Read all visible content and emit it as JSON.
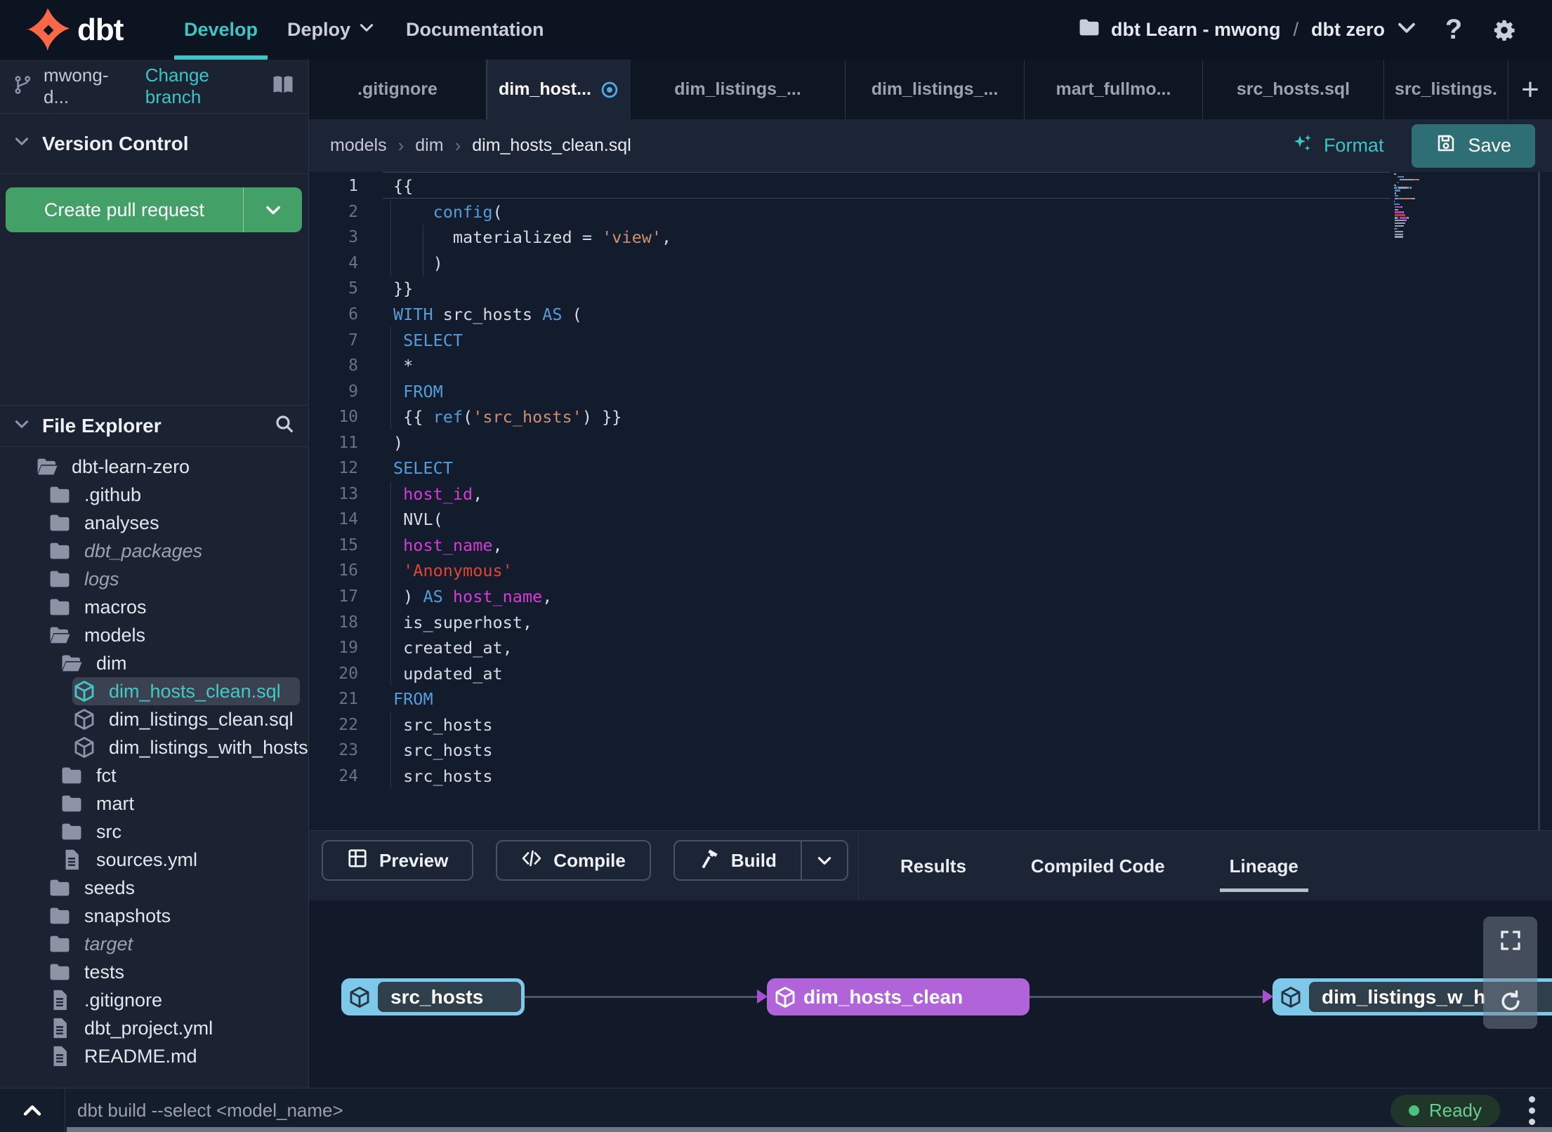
{
  "colors": {
    "accent_teal": "#3EC4C4",
    "green_button": "#43A168",
    "save_button": "#2E6F75",
    "node_source_blue": "#7EC8E9",
    "node_model_purple": "#B164DA",
    "ready_green": "#67CD93",
    "code_keyword": "#559CD8",
    "code_string": "#CE8F70",
    "code_string_red": "#E0452F",
    "code_field": "#D73BD8"
  },
  "topnav": {
    "brand": "dbt",
    "items": [
      {
        "label": "Develop",
        "active": true
      },
      {
        "label": "Deploy",
        "chevron": true
      },
      {
        "label": "Documentation"
      }
    ],
    "project": {
      "name": "dbt Learn - mwong",
      "sep": "/",
      "env": "dbt zero"
    }
  },
  "sidebar": {
    "branch": {
      "name": "mwong-d...",
      "action": "Change branch"
    },
    "version_control": {
      "title": "Version Control",
      "button": "Create pull request"
    },
    "file_explorer": {
      "title": "File Explorer",
      "items": [
        {
          "label": "dbt-learn-zero",
          "depth": 1,
          "icon": "folder-open"
        },
        {
          "label": ".github",
          "depth": 2,
          "icon": "folder"
        },
        {
          "label": "analyses",
          "depth": 2,
          "icon": "folder"
        },
        {
          "label": "dbt_packages",
          "depth": 2,
          "icon": "folder",
          "italic": true
        },
        {
          "label": "logs",
          "depth": 2,
          "icon": "folder",
          "italic": true
        },
        {
          "label": "macros",
          "depth": 2,
          "icon": "folder"
        },
        {
          "label": "models",
          "depth": 2,
          "icon": "folder-open"
        },
        {
          "label": "dim",
          "depth": 3,
          "icon": "folder-open"
        },
        {
          "label": "dim_hosts_clean.sql",
          "depth": 4,
          "icon": "cube",
          "selected": true,
          "dot": true
        },
        {
          "label": "dim_listings_clean.sql",
          "depth": 4,
          "icon": "cube"
        },
        {
          "label": "dim_listings_with_hosts...",
          "depth": 4,
          "icon": "cube"
        },
        {
          "label": "fct",
          "depth": 3,
          "icon": "folder"
        },
        {
          "label": "mart",
          "depth": 3,
          "icon": "folder"
        },
        {
          "label": "src",
          "depth": 3,
          "icon": "folder"
        },
        {
          "label": "sources.yml",
          "depth": 3,
          "icon": "file"
        },
        {
          "label": "seeds",
          "depth": 2,
          "icon": "folder"
        },
        {
          "label": "snapshots",
          "depth": 2,
          "icon": "folder"
        },
        {
          "label": "target",
          "depth": 2,
          "icon": "folder",
          "italic": true
        },
        {
          "label": "tests",
          "depth": 2,
          "icon": "folder"
        },
        {
          "label": ".gitignore",
          "depth": 2,
          "icon": "file"
        },
        {
          "label": "dbt_project.yml",
          "depth": 2,
          "icon": "file"
        },
        {
          "label": "README.md",
          "depth": 2,
          "icon": "file"
        }
      ]
    }
  },
  "tabs": {
    "items": [
      {
        "label": ".gitignore"
      },
      {
        "label": "dim_host...",
        "active": true,
        "dirty": true
      },
      {
        "label": "dim_listings_..."
      },
      {
        "label": "dim_listings_..."
      },
      {
        "label": "mart_fullmo..."
      },
      {
        "label": "src_hosts.sql"
      },
      {
        "label": "src_listings."
      }
    ],
    "add": "+"
  },
  "breadcrumb": {
    "items": [
      "models",
      "dim",
      "dim_hosts_clean.sql"
    ]
  },
  "actions": {
    "format": "Format",
    "save": "Save"
  },
  "editor": {
    "lines": [
      {
        "n": "1",
        "seg": [
          [
            "p",
            "{{"
          ]
        ]
      },
      {
        "n": "2",
        "seg": [
          [
            "p",
            "    "
          ],
          [
            "kw",
            "config"
          ],
          [
            "p",
            "("
          ]
        ]
      },
      {
        "n": "3",
        "seg": [
          [
            "p",
            "      materialized = "
          ],
          [
            "str",
            "'view'"
          ],
          [
            "p",
            ","
          ]
        ]
      },
      {
        "n": "4",
        "seg": [
          [
            "p",
            "    )"
          ]
        ]
      },
      {
        "n": "5",
        "seg": [
          [
            "p",
            "}}"
          ]
        ]
      },
      {
        "n": "6",
        "seg": [
          [
            "kw",
            "WITH"
          ],
          [
            "p",
            " src_hosts "
          ],
          [
            "kw",
            "AS"
          ],
          [
            "p",
            " ("
          ]
        ]
      },
      {
        "n": "7",
        "seg": [
          [
            "p",
            " "
          ],
          [
            "kw",
            "SELECT"
          ]
        ]
      },
      {
        "n": "8",
        "seg": [
          [
            "p",
            " *"
          ]
        ]
      },
      {
        "n": "9",
        "seg": [
          [
            "p",
            " "
          ],
          [
            "kw",
            "FROM"
          ]
        ]
      },
      {
        "n": "10",
        "seg": [
          [
            "p",
            " {{ "
          ],
          [
            "kw",
            "ref"
          ],
          [
            "p",
            "("
          ],
          [
            "str",
            "'src_hosts'"
          ],
          [
            "p",
            ") }}"
          ]
        ]
      },
      {
        "n": "11",
        "seg": [
          [
            "p",
            ")"
          ]
        ]
      },
      {
        "n": "12",
        "seg": [
          [
            "kw",
            "SELECT"
          ]
        ]
      },
      {
        "n": "13",
        "seg": [
          [
            "p",
            " "
          ],
          [
            "mag",
            "host_id"
          ],
          [
            "p",
            ","
          ]
        ]
      },
      {
        "n": "14",
        "seg": [
          [
            "p",
            " NVL("
          ]
        ]
      },
      {
        "n": "15",
        "seg": [
          [
            "p",
            " "
          ],
          [
            "mag",
            "host_name"
          ],
          [
            "p",
            ","
          ]
        ]
      },
      {
        "n": "16",
        "seg": [
          [
            "p",
            " "
          ],
          [
            "red",
            "'Anonymous'"
          ]
        ]
      },
      {
        "n": "17",
        "seg": [
          [
            "p",
            " ) "
          ],
          [
            "kw",
            "AS"
          ],
          [
            "p",
            " "
          ],
          [
            "mag",
            "host_name"
          ],
          [
            "p",
            ","
          ]
        ]
      },
      {
        "n": "18",
        "seg": [
          [
            "p",
            " is_superhost,"
          ]
        ]
      },
      {
        "n": "19",
        "seg": [
          [
            "p",
            " created_at,"
          ]
        ]
      },
      {
        "n": "20",
        "seg": [
          [
            "p",
            " updated_at"
          ]
        ]
      },
      {
        "n": "21",
        "seg": [
          [
            "kw",
            "FROM"
          ]
        ]
      },
      {
        "n": "22",
        "seg": [
          [
            "p",
            " src_hosts"
          ]
        ]
      },
      {
        "n": "23",
        "seg": [
          [
            "p",
            " src_hosts"
          ]
        ]
      },
      {
        "n": "24",
        "seg": [
          [
            "p",
            " src_hosts"
          ]
        ]
      }
    ]
  },
  "panel": {
    "buttons": [
      {
        "label": "Preview",
        "icon": "grid"
      },
      {
        "label": "Compile",
        "icon": "code"
      },
      {
        "label": "Build",
        "icon": "hammer",
        "split": true
      }
    ],
    "tabs": [
      {
        "label": "Results"
      },
      {
        "label": "Compiled Code"
      },
      {
        "label": "Lineage",
        "active": true
      }
    ]
  },
  "lineage": {
    "nodes": [
      {
        "label": "src_hosts",
        "kind": "src"
      },
      {
        "label": "dim_hosts_clean",
        "kind": "model"
      },
      {
        "label": "dim_listings_w_h",
        "kind": "src"
      }
    ]
  },
  "bottombar": {
    "command": "dbt build --select <model_name>",
    "status": "Ready"
  }
}
